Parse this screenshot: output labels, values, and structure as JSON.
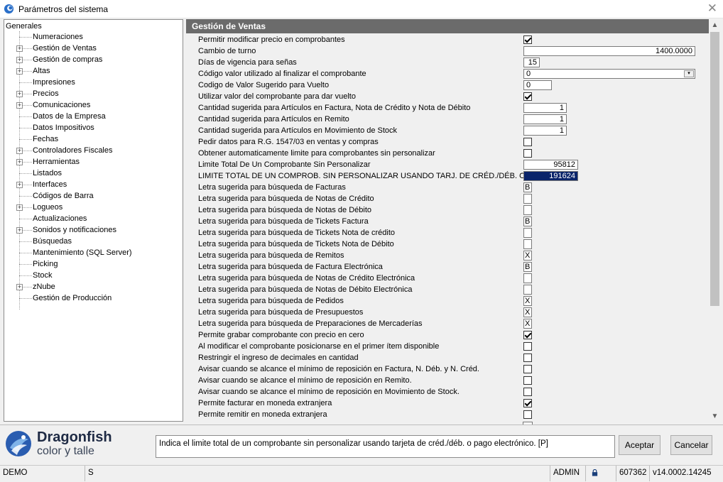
{
  "window": {
    "title": "Parámetros del sistema",
    "close_glyph": "✕"
  },
  "tree": {
    "root": "Generales",
    "items": [
      {
        "label": "Numeraciones",
        "expandable": false
      },
      {
        "label": "Gestión de Ventas",
        "expandable": true
      },
      {
        "label": "Gestión de compras",
        "expandable": true
      },
      {
        "label": "Altas",
        "expandable": true
      },
      {
        "label": "Impresiones",
        "expandable": false
      },
      {
        "label": "Precios",
        "expandable": true
      },
      {
        "label": "Comunicaciones",
        "expandable": true
      },
      {
        "label": "Datos de la Empresa",
        "expandable": false
      },
      {
        "label": "Datos Impositivos",
        "expandable": false
      },
      {
        "label": "Fechas",
        "expandable": false
      },
      {
        "label": "Controladores Fiscales",
        "expandable": true
      },
      {
        "label": "Herramientas",
        "expandable": true
      },
      {
        "label": "Listados",
        "expandable": false
      },
      {
        "label": "Interfaces",
        "expandable": true
      },
      {
        "label": "Códigos de Barra",
        "expandable": false
      },
      {
        "label": "Logueos",
        "expandable": true
      },
      {
        "label": "Actualizaciones",
        "expandable": false
      },
      {
        "label": "Sonidos y notificaciones",
        "expandable": true
      },
      {
        "label": "Búsquedas",
        "expandable": false
      },
      {
        "label": "Mantenimiento (SQL Server)",
        "expandable": false
      },
      {
        "label": "Picking",
        "expandable": false
      },
      {
        "label": "Stock",
        "expandable": false
      },
      {
        "label": "zNube",
        "expandable": true
      },
      {
        "label": "Gestión de Producción",
        "expandable": false
      }
    ]
  },
  "section": {
    "title": "Gestión de Ventas",
    "rows": [
      {
        "label": "Permitir modificar precio en comprobantes",
        "type": "check",
        "checked": true
      },
      {
        "label": "Cambio de turno",
        "type": "num",
        "value": "1400.0000",
        "width": "wide"
      },
      {
        "label": "Días de vigencia para señas",
        "type": "num",
        "value": "15",
        "width": "tiny"
      },
      {
        "label": "Código valor utilizado al finalizar el comprobante",
        "type": "combo",
        "value": "0"
      },
      {
        "label": "Codigo de Valor Sugerido para Vuelto",
        "type": "text",
        "value": "0"
      },
      {
        "label": "Utilizar valor del comprobante para dar vuelto",
        "type": "check",
        "checked": true
      },
      {
        "label": "Cantidad sugerida para Artículos en Factura, Nota de Crédito y Nota de Débito",
        "type": "num",
        "value": "1",
        "width": "small"
      },
      {
        "label": "Cantidad sugerida para Artículos en Remito",
        "type": "num",
        "value": "1",
        "width": "small"
      },
      {
        "label": "Cantidad sugerida para Artículos en Movimiento de Stock",
        "type": "num",
        "value": "1",
        "width": "small"
      },
      {
        "label": "Pedir datos para R.G. 1547/03 en ventas y compras",
        "type": "check",
        "checked": false
      },
      {
        "label": "Obtener automaticamente limite para comprobantes sin personalizar",
        "type": "check",
        "checked": false
      },
      {
        "label": "Limite Total De Un Comprobante Sin Personalizar",
        "type": "num",
        "value": "95812",
        "width": "medium"
      },
      {
        "label": "LIMITE TOTAL DE UN COMPROB. SIN PERSONALIZAR USANDO TARJ. DE CRÉD./DÉB. O PAGO.",
        "type": "num",
        "value": "191624",
        "width": "medium",
        "selected": true
      },
      {
        "label": "Letra sugerida para búsqueda de Facturas",
        "type": "letter",
        "value": "B"
      },
      {
        "label": "Letra sugerida para búsqueda de Notas de Crédito",
        "type": "letter",
        "value": ""
      },
      {
        "label": "Letra sugerida para búsqueda de Notas de Débito",
        "type": "letter",
        "value": ""
      },
      {
        "label": "Letra sugerida para búsqueda de Tickets Factura",
        "type": "letter",
        "value": "B"
      },
      {
        "label": "Letra sugerida para búsqueda de Tickets Nota de crédito",
        "type": "letter",
        "value": ""
      },
      {
        "label": "Letra sugerida para búsqueda de Tickets Nota de Débito",
        "type": "letter",
        "value": ""
      },
      {
        "label": "Letra sugerida para búsqueda de Remitos",
        "type": "letter",
        "value": "X"
      },
      {
        "label": "Letra sugerida para búsqueda de Factura Electrónica",
        "type": "letter",
        "value": "B"
      },
      {
        "label": "Letra sugerida para búsqueda de Notas de Crédito Electrónica",
        "type": "letter",
        "value": ""
      },
      {
        "label": "Letra sugerida para búsqueda de Notas de Débito Electrónica",
        "type": "letter",
        "value": ""
      },
      {
        "label": "Letra sugerida para búsqueda de Pedidos",
        "type": "letter",
        "value": "X"
      },
      {
        "label": "Letra sugerida para búsqueda de Presupuestos",
        "type": "letter",
        "value": "X"
      },
      {
        "label": "Letra sugerida para búsqueda de Preparaciones de Mercaderías",
        "type": "letter",
        "value": "X"
      },
      {
        "label": "Permite grabar comprobante con precio en cero",
        "type": "check",
        "checked": true
      },
      {
        "label": "Al modificar el comprobante posicionarse en el primer ítem disponible",
        "type": "check",
        "checked": false
      },
      {
        "label": "Restringir el ingreso de decimales en cantidad",
        "type": "check",
        "checked": false
      },
      {
        "label": "Avisar cuando se alcance el mínimo de reposición en Factura, N. Déb. y N. Créd.",
        "type": "check",
        "checked": false
      },
      {
        "label": "Avisar cuando se alcance el mínimo de reposición en Remito.",
        "type": "check",
        "checked": false
      },
      {
        "label": "Avisar cuando se alcance el mínimo de reposición en Movimiento de Stock.",
        "type": "check",
        "checked": false
      },
      {
        "label": "Permite facturar en moneda extranjera",
        "type": "check",
        "checked": true
      },
      {
        "label": "Permite remitir en moneda extranjera",
        "type": "check",
        "checked": false
      }
    ]
  },
  "branding": {
    "name": "Dragonfish",
    "tagline": "color y talle",
    "logo_colors": [
      "#2a5db0",
      "#4a90d9",
      "#7fb3e8"
    ]
  },
  "help_text": "Indica el limite total de un comprobante sin personalizar usando tarjeta de créd./déb. o pago electrónico. [P]",
  "buttons": {
    "accept": "Aceptar",
    "cancel": "Cancelar"
  },
  "statusbar": {
    "mode": "DEMO",
    "flag": "S",
    "user": "ADMIN",
    "lock_icon": "lock-icon",
    "code": "607362",
    "version": "v14.0002.14245"
  }
}
